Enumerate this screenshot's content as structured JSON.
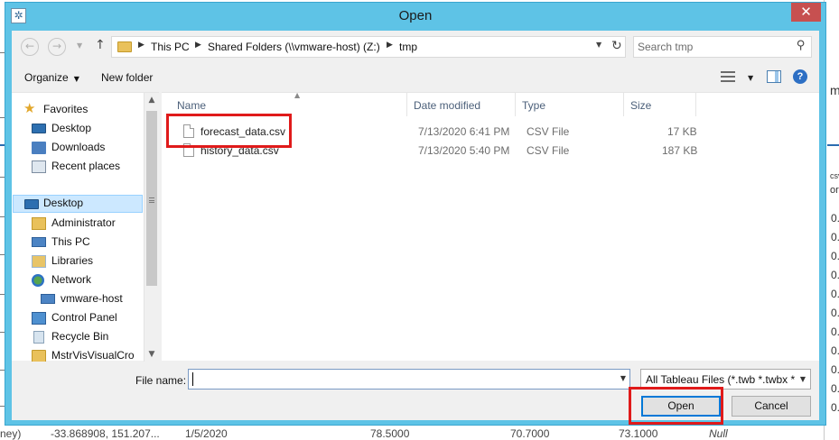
{
  "window": {
    "title": "Open"
  },
  "titlebar": {
    "close_glyph": "✕"
  },
  "address_bar": {
    "crumbs": [
      "This PC",
      "Shared Folders (\\\\vmware-host) (Z:)",
      "tmp"
    ]
  },
  "search": {
    "placeholder": "Search tmp"
  },
  "toolbar": {
    "organize_label": "Organize",
    "new_folder_label": "New folder"
  },
  "nav_tree": {
    "items": [
      {
        "label": "Favorites",
        "icon": "star-icon"
      },
      {
        "label": "Desktop",
        "icon": "desktop-icon"
      },
      {
        "label": "Downloads",
        "icon": "downloads-icon"
      },
      {
        "label": "Recent places",
        "icon": "recent-places-icon"
      },
      {
        "label": "Desktop",
        "icon": "desktop-icon",
        "selected": true
      },
      {
        "label": "Administrator",
        "icon": "user-folder-icon"
      },
      {
        "label": "This PC",
        "icon": "computer-icon"
      },
      {
        "label": "Libraries",
        "icon": "libraries-icon"
      },
      {
        "label": "Network",
        "icon": "network-icon"
      },
      {
        "label": "vmware-host",
        "icon": "computer-icon"
      },
      {
        "label": "Control Panel",
        "icon": "control-panel-icon"
      },
      {
        "label": "Recycle Bin",
        "icon": "recycle-bin-icon"
      },
      {
        "label": "MstrVisVisualCro",
        "icon": "folder-icon"
      }
    ]
  },
  "file_list": {
    "columns": [
      "Name",
      "Date modified",
      "Type",
      "Size"
    ],
    "rows": [
      {
        "name": "forecast_data.csv",
        "date_modified": "7/13/2020 6:41 PM",
        "type": "CSV File",
        "size": "17 KB"
      },
      {
        "name": "history_data.csv",
        "date_modified": "7/13/2020 5:40 PM",
        "type": "CSV File",
        "size": "187 KB"
      }
    ]
  },
  "file_name": {
    "label": "File name:",
    "value": ""
  },
  "file_type_filter": {
    "selected": "All Tableau Files (*.twb *.twbx *"
  },
  "buttons": {
    "open_label": "Open",
    "cancel_label": "Cancel"
  },
  "background_app": {
    "right_header_char": "m",
    "right_col_header": "csv",
    "right_col_sub": "or",
    "right_col_values": [
      "0.",
      "0.",
      "0.",
      "0.",
      "0.",
      "0.",
      "0.",
      "0.",
      "0.",
      "0.",
      "0."
    ],
    "bottom_row": [
      "ney)",
      "-33.868908, 151.207...",
      "1/5/2020",
      "78.5000",
      "70.7000",
      "73.1000",
      "Null"
    ]
  },
  "colors": {
    "title_bar": "#5ec3e6",
    "close_button": "#c75050",
    "highlight": "#e01a1a",
    "selection": "#cce8ff"
  }
}
